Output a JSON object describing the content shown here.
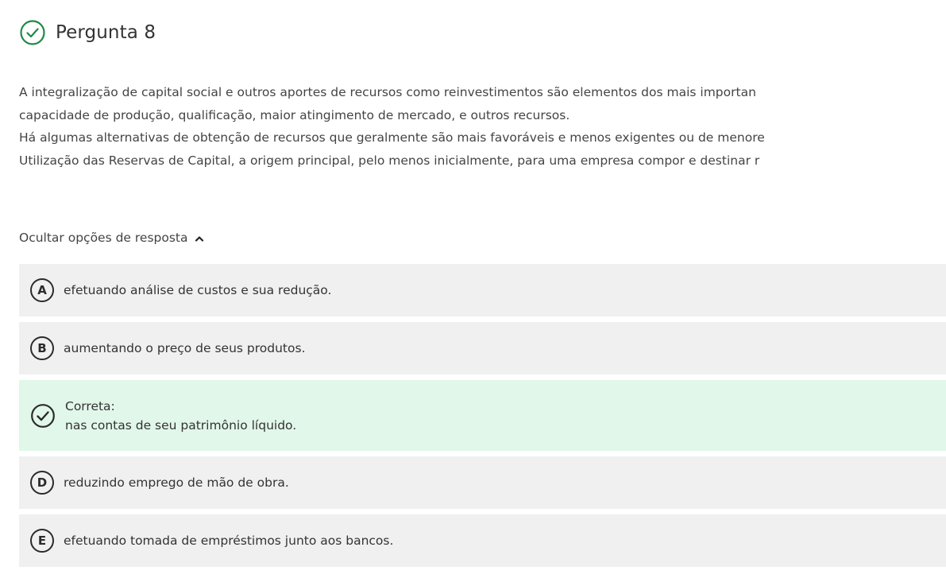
{
  "question": {
    "title": "Pergunta 8",
    "status_color": "#1e8a45"
  },
  "stem": {
    "lines": [
      "A integralização de capital social e outros aportes de recursos como reinvestimentos são elementos dos mais importan",
      "capacidade de produção, qualificação, maior atingimento de mercado, e outros recursos.",
      "Há algumas alternativas de obtenção de recursos que geralmente são mais favoráveis e menos exigentes ou de menore",
      "Utilização das Reservas de Capital, a origem principal, pelo menos inicialmente, para uma empresa compor e destinar r"
    ]
  },
  "toggle": {
    "label": "Ocultar opções de resposta",
    "icon": "chevron-up-icon"
  },
  "options": [
    {
      "letter": "A",
      "text": "efetuando análise de custos e sua redução."
    },
    {
      "letter": "B",
      "text": "aumentando o preço de seus produtos."
    },
    {
      "correct_label": "Correta:",
      "text": "nas contas de seu patrimônio líquido.",
      "icon": "check-circle-icon",
      "highlight_color": "#e1f7ea"
    },
    {
      "letter": "D",
      "text": "reduzindo emprego de mão de obra."
    },
    {
      "letter": "E",
      "text": "efetuando tomada de empréstimos junto aos bancos."
    }
  ]
}
